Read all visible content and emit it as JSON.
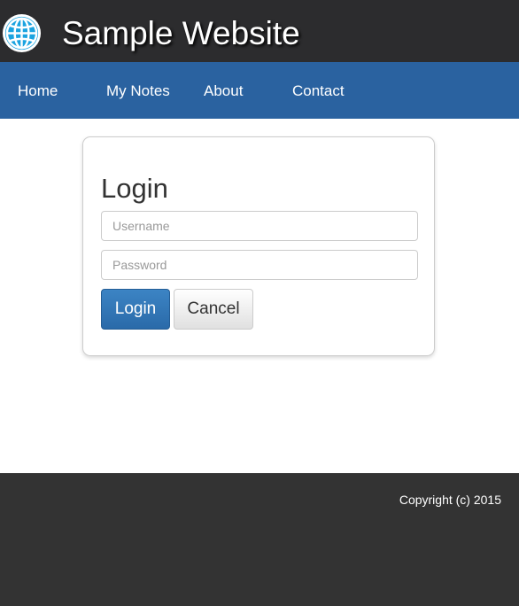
{
  "header": {
    "title": "Sample Website",
    "logo_icon": "globe-icon"
  },
  "nav": {
    "items": [
      {
        "label": "Home"
      },
      {
        "label": "My Notes"
      },
      {
        "label": "About"
      },
      {
        "label": "Contact"
      }
    ]
  },
  "login": {
    "title": "Login",
    "username_placeholder": "Username",
    "password_placeholder": "Password",
    "login_label": "Login",
    "cancel_label": "Cancel"
  },
  "footer": {
    "copyright": "Copyright (c) 2015"
  },
  "colors": {
    "nav": "#2a62a0",
    "header": "#2c2c2e",
    "footer": "#333333",
    "primary": "#337ab7"
  }
}
